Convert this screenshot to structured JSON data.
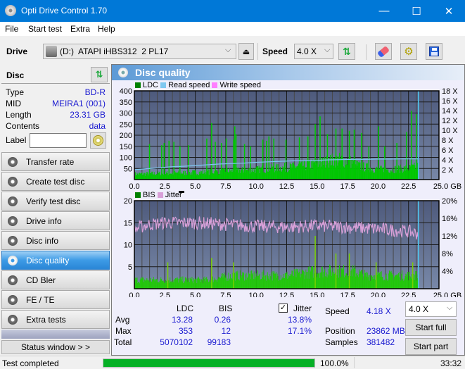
{
  "window": {
    "title": "Opti Drive Control 1.70",
    "minimize_glyph": "—",
    "maximize_glyph": "☐",
    "close_glyph": "✕"
  },
  "menu": [
    "File",
    "Start test",
    "Extra",
    "Help"
  ],
  "toolbar": {
    "drive_label": "Drive",
    "drive_value": "(D:)  ATAPI iHBS312  2 PL17",
    "speed_label": "Speed",
    "speed_value": "4.0 X",
    "icons": [
      "drive-icon",
      "eject-icon",
      "refresh-icon",
      "eraser-icon",
      "settings-icon",
      "save-icon"
    ]
  },
  "disc": {
    "header": "Disc",
    "rows": [
      {
        "key": "Type",
        "value": "BD-R"
      },
      {
        "key": "MID",
        "value": "MEIRA1 (001)"
      },
      {
        "key": "Length",
        "value": "23.31 GB"
      },
      {
        "key": "Contents",
        "value": "data"
      }
    ],
    "label_key": "Label",
    "label_value": ""
  },
  "sidebar": {
    "items": [
      {
        "label": "Transfer rate",
        "active": false
      },
      {
        "label": "Create test disc",
        "active": false
      },
      {
        "label": "Verify test disc",
        "active": false
      },
      {
        "label": "Drive info",
        "active": false
      },
      {
        "label": "Disc info",
        "active": false
      },
      {
        "label": "Disc quality",
        "active": true
      },
      {
        "label": "CD Bler",
        "active": false
      },
      {
        "label": "FE / TE",
        "active": false
      },
      {
        "label": "Extra tests",
        "active": false
      }
    ],
    "status_window_label": "Status window > >"
  },
  "panel": {
    "title": "Disc quality"
  },
  "colors": {
    "ldc": "#00c800",
    "read_speed": "#7fc8f0",
    "write_speed": "#ff80ff",
    "bis": "#00c800",
    "jitter": "#d8a0d8",
    "plot_bg_top": "#4e5a7c",
    "plot_bg_bottom": "#7888a8",
    "value_text": "#1a1ad0",
    "progress": "#06b025"
  },
  "chart_data": [
    {
      "type": "bar",
      "title": "LDC",
      "legend": [
        "LDC",
        "Read speed",
        "Write speed"
      ],
      "legend_position": "top-left",
      "xlabel": "GB",
      "x_ticks": [
        "0.0",
        "2.5",
        "5.0",
        "7.5",
        "10.0",
        "12.5",
        "15.0",
        "17.5",
        "20.0",
        "22.5",
        "25.0 GB"
      ],
      "xlim": [
        0,
        25
      ],
      "y_ticks": [
        "50",
        "100",
        "150",
        "200",
        "250",
        "300",
        "350",
        "400"
      ],
      "ylim": [
        0,
        400
      ],
      "y2_ticks": [
        "2 X",
        "4 X",
        "6 X",
        "8 X",
        "10 X",
        "12 X",
        "14 X",
        "16 X",
        "18 X"
      ],
      "y2lim": [
        0,
        18
      ],
      "grid": true,
      "end_position_gb": 23.31,
      "ldc_baseline": [
        {
          "x": 0,
          "y": 25
        },
        {
          "x": 2.5,
          "y": 28
        },
        {
          "x": 5,
          "y": 32
        },
        {
          "x": 7.5,
          "y": 38
        },
        {
          "x": 10,
          "y": 45
        },
        {
          "x": 12.5,
          "y": 55
        },
        {
          "x": 15,
          "y": 70
        },
        {
          "x": 16.5,
          "y": 90
        },
        {
          "x": 17.5,
          "y": 85
        },
        {
          "x": 18.5,
          "y": 60
        },
        {
          "x": 20,
          "y": 45
        },
        {
          "x": 22.5,
          "y": 50
        },
        {
          "x": 23.31,
          "y": 60
        }
      ],
      "ldc_spikes": [
        {
          "x": 1.2,
          "y": 160
        },
        {
          "x": 2.2,
          "y": 155
        },
        {
          "x": 2.4,
          "y": 165
        },
        {
          "x": 2.8,
          "y": 175
        },
        {
          "x": 3.2,
          "y": 170
        },
        {
          "x": 3.7,
          "y": 150
        },
        {
          "x": 4.4,
          "y": 155
        },
        {
          "x": 5.9,
          "y": 185
        },
        {
          "x": 6.3,
          "y": 255
        },
        {
          "x": 6.6,
          "y": 170
        },
        {
          "x": 7.1,
          "y": 165
        },
        {
          "x": 7.5,
          "y": 185
        },
        {
          "x": 8.1,
          "y": 180
        },
        {
          "x": 8.2,
          "y": 240
        },
        {
          "x": 8.3,
          "y": 205
        },
        {
          "x": 9.0,
          "y": 160
        },
        {
          "x": 9.5,
          "y": 150
        },
        {
          "x": 10.5,
          "y": 180
        },
        {
          "x": 10.8,
          "y": 175
        },
        {
          "x": 11.0,
          "y": 195
        },
        {
          "x": 11.4,
          "y": 185
        },
        {
          "x": 12.4,
          "y": 180
        },
        {
          "x": 13.5,
          "y": 190
        },
        {
          "x": 14.2,
          "y": 195
        },
        {
          "x": 14.8,
          "y": 250
        },
        {
          "x": 15.2,
          "y": 285
        },
        {
          "x": 15.8,
          "y": 205
        },
        {
          "x": 16.5,
          "y": 230
        },
        {
          "x": 17.0,
          "y": 230
        },
        {
          "x": 17.6,
          "y": 220
        },
        {
          "x": 18.0,
          "y": 225
        },
        {
          "x": 18.6,
          "y": 210
        },
        {
          "x": 19.2,
          "y": 150
        },
        {
          "x": 20.0,
          "y": 240
        },
        {
          "x": 20.5,
          "y": 150
        },
        {
          "x": 21.5,
          "y": 165
        },
        {
          "x": 22.3,
          "y": 215
        },
        {
          "x": 22.7,
          "y": 310
        },
        {
          "x": 23.1,
          "y": 295
        }
      ],
      "read_speed": [
        {
          "x": 0,
          "y": 2.0
        },
        {
          "x": 1,
          "y": 2.2
        },
        {
          "x": 2,
          "y": 2.4
        },
        {
          "x": 3,
          "y": 2.6
        },
        {
          "x": 4,
          "y": 2.7
        },
        {
          "x": 5,
          "y": 2.85
        },
        {
          "x": 6,
          "y": 3.0
        },
        {
          "x": 7,
          "y": 3.15
        },
        {
          "x": 8,
          "y": 3.25
        },
        {
          "x": 9,
          "y": 3.35
        },
        {
          "x": 10,
          "y": 3.5
        },
        {
          "x": 11,
          "y": 3.6
        },
        {
          "x": 12,
          "y": 3.7
        },
        {
          "x": 13,
          "y": 3.8
        },
        {
          "x": 14,
          "y": 3.85
        },
        {
          "x": 15,
          "y": 3.9
        },
        {
          "x": 16,
          "y": 4.0
        },
        {
          "x": 17,
          "y": 4.05
        },
        {
          "x": 18,
          "y": 4.1
        },
        {
          "x": 19,
          "y": 4.1
        },
        {
          "x": 20,
          "y": 4.15
        },
        {
          "x": 21,
          "y": 4.15
        },
        {
          "x": 22,
          "y": 4.18
        },
        {
          "x": 23.31,
          "y": 4.18
        }
      ]
    },
    {
      "type": "bar",
      "title": "BIS",
      "legend": [
        "BIS",
        "Jitter"
      ],
      "legend_position": "top-left",
      "xlabel": "GB",
      "x_ticks": [
        "0.0",
        "2.5",
        "5.0",
        "7.5",
        "10.0",
        "12.5",
        "15.0",
        "17.5",
        "20.0",
        "22.5",
        "25.0 GB"
      ],
      "xlim": [
        0,
        25
      ],
      "y_ticks": [
        "5",
        "10",
        "15",
        "20"
      ],
      "ylim": [
        0,
        20
      ],
      "y2_ticks": [
        "4%",
        "8%",
        "12%",
        "16%",
        "20%"
      ],
      "y2lim": [
        0,
        20
      ],
      "grid": true,
      "end_position_gb": 23.31,
      "bis_baseline": [
        {
          "x": 0,
          "y": 2
        },
        {
          "x": 6,
          "y": 2
        },
        {
          "x": 8,
          "y": 3
        },
        {
          "x": 12.5,
          "y": 3
        },
        {
          "x": 15,
          "y": 4
        },
        {
          "x": 18,
          "y": 4
        },
        {
          "x": 19,
          "y": 3
        },
        {
          "x": 23.31,
          "y": 3
        }
      ],
      "bis_spikes": [
        {
          "x": 2.7,
          "y": 6
        },
        {
          "x": 6.3,
          "y": 7
        },
        {
          "x": 8.1,
          "y": 6
        },
        {
          "x": 14.8,
          "y": 12
        },
        {
          "x": 16.5,
          "y": 8
        },
        {
          "x": 17.6,
          "y": 8
        },
        {
          "x": 19.8,
          "y": 6
        },
        {
          "x": 22.8,
          "y": 6
        }
      ],
      "jitter_mean": [
        {
          "x": 0,
          "y": 13.5
        },
        {
          "x": 1,
          "y": 14.5
        },
        {
          "x": 2.5,
          "y": 15.0
        },
        {
          "x": 5,
          "y": 15.0
        },
        {
          "x": 7.5,
          "y": 14.6
        },
        {
          "x": 10,
          "y": 14.2
        },
        {
          "x": 12.5,
          "y": 14.0
        },
        {
          "x": 15,
          "y": 14.3
        },
        {
          "x": 17.5,
          "y": 14.0
        },
        {
          "x": 20,
          "y": 13.6
        },
        {
          "x": 22.5,
          "y": 13.0
        },
        {
          "x": 23.31,
          "y": 12.5
        }
      ]
    }
  ],
  "stats": {
    "col_ldc": "LDC",
    "col_bis": "BIS",
    "jitter_label": "Jitter",
    "jitter_checked": true,
    "rows": [
      {
        "label": "Avg",
        "ldc": "13.28",
        "bis": "0.26",
        "jitter": "13.8%"
      },
      {
        "label": "Max",
        "ldc": "353",
        "bis": "12",
        "jitter": "17.1%"
      },
      {
        "label": "Total",
        "ldc": "5070102",
        "bis": "99183",
        "jitter": ""
      }
    ],
    "speed_label": "Speed",
    "speed_value": "4.18 X",
    "position_label": "Position",
    "position_value": "23862 MB",
    "samples_label": "Samples",
    "samples_value": "381482",
    "speed_select": "4.0 X",
    "start_full": "Start full",
    "start_part": "Start part"
  },
  "status": {
    "text": "Test completed",
    "progress_percent": 100.0,
    "progress_text": "100.0%",
    "time": "33:32"
  }
}
